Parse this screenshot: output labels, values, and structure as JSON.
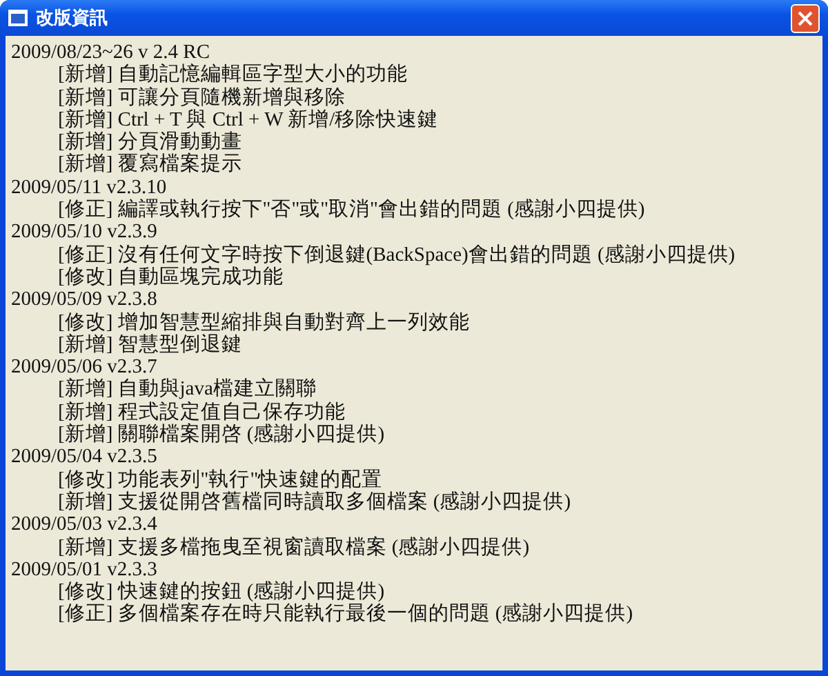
{
  "window": {
    "title": "改版資訊"
  },
  "versions": [
    {
      "heading": "2009/08/23~26 v 2.4 RC",
      "items": [
        "[新增] 自動記憶編輯區字型大小的功能",
        "[新增] 可讓分頁隨機新增與移除",
        "[新增] Ctrl + T 與 Ctrl + W 新增/移除快速鍵",
        "[新增] 分頁滑動動畫",
        "[新增] 覆寫檔案提示"
      ]
    },
    {
      "heading": "2009/05/11 v2.3.10",
      "items": [
        "[修正] 編譯或執行按下\"否\"或\"取消\"會出錯的問題 (感謝小四提供)"
      ]
    },
    {
      "heading": "2009/05/10 v2.3.9",
      "items": [
        "[修正] 沒有任何文字時按下倒退鍵(BackSpace)會出錯的問題 (感謝小四提供)",
        "[修改] 自動區塊完成功能"
      ]
    },
    {
      "heading": "2009/05/09 v2.3.8",
      "items": [
        "[修改] 增加智慧型縮排與自動對齊上一列效能",
        "[新增] 智慧型倒退鍵"
      ]
    },
    {
      "heading": "2009/05/06 v2.3.7",
      "items": [
        "[新增] 自動與java檔建立關聯",
        "[新增] 程式設定值自己保存功能",
        "[新增] 關聯檔案開啓 (感謝小四提供)"
      ]
    },
    {
      "heading": "2009/05/04 v2.3.5",
      "items": [
        "[修改] 功能表列\"執行\"快速鍵的配置",
        "[新增] 支援從開啓舊檔同時讀取多個檔案 (感謝小四提供)"
      ]
    },
    {
      "heading": "2009/05/03 v2.3.4",
      "items": [
        "[新增] 支援多檔拖曳至視窗讀取檔案 (感謝小四提供)"
      ]
    },
    {
      "heading": "2009/05/01 v2.3.3",
      "items": [
        "[修改] 快速鍵的按鈕 (感謝小四提供)",
        "[修正] 多個檔案存在時只能執行最後一個的問題 (感謝小四提供)"
      ]
    }
  ]
}
